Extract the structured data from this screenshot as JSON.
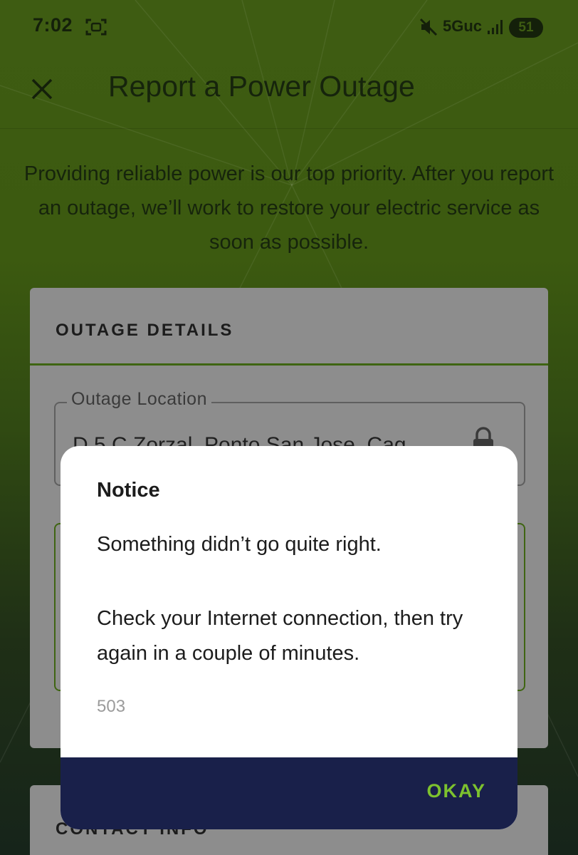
{
  "status_bar": {
    "time": "7:02",
    "network": "5Guc",
    "battery": "51",
    "icons": [
      "screenshot-icon",
      "mute-icon",
      "signal-icon",
      "battery-icon"
    ]
  },
  "header": {
    "title": "Report a Power Outage",
    "close_icon": "close-icon"
  },
  "intro_text": "Providing reliable power is our top priority. After you report an outage, we’ll work to restore your electric service as soon as possible.",
  "outage_card": {
    "title": "OUTAGE DETAILS",
    "location_label": "Outage Location",
    "location_value": "D 5 C Zorzal, Ponto San Jose, Cag",
    "lock_icon": "lock-icon"
  },
  "contact_card": {
    "title": "CONTACT INFO"
  },
  "dialog": {
    "title": "Notice",
    "message": "Something didn’t go quite right.",
    "instruction": "Check your Internet connection, then try again in a couple of minutes.",
    "code": "503",
    "okay_label": "OKAY"
  },
  "colors": {
    "background_top": "#3e5c12",
    "background_bottom": "#16241a",
    "card_overlay": "#8d8d8d",
    "accent_green": "#7dc22e",
    "dialog_footer": "#19204a"
  }
}
